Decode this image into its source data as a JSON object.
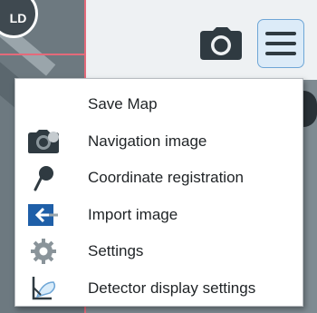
{
  "user": {
    "initials": "LD"
  },
  "toolbar": {
    "camera_icon": "camera-icon",
    "menu_icon": "hamburger-menu-icon"
  },
  "menu": {
    "items": [
      {
        "label": "Save Map",
        "icon": ""
      },
      {
        "label": "Navigation image",
        "icon": "navigation-image-icon"
      },
      {
        "label": "Coordinate registration",
        "icon": "pin-icon"
      },
      {
        "label": "Import image",
        "icon": "import-icon"
      },
      {
        "label": "Settings",
        "icon": "gear-icon"
      },
      {
        "label": "Detector display settings",
        "icon": "detector-icon"
      }
    ]
  },
  "colors": {
    "accent": "#6ea6d6",
    "icon_dark": "#2f3a41",
    "import_blue": "#1f5fa8",
    "menu_bg": "#ffffff"
  }
}
